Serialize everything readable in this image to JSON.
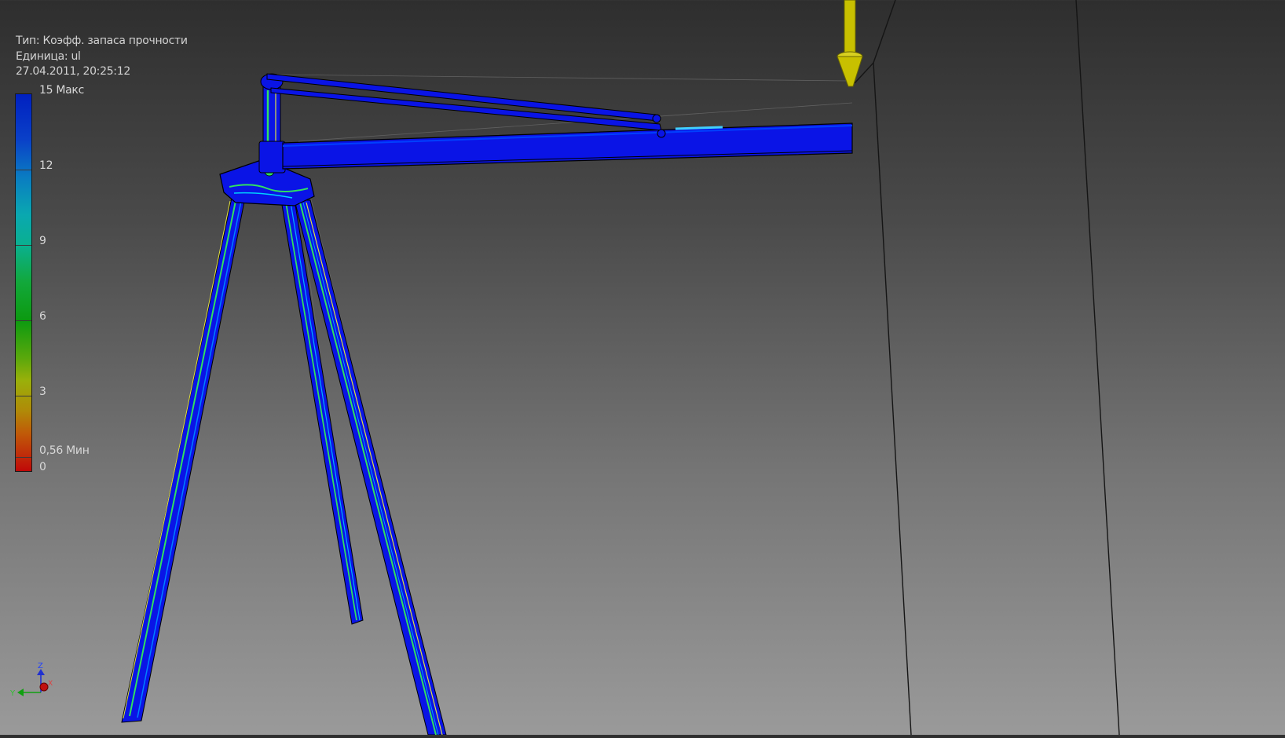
{
  "info": {
    "type_line": "Тип: Коэфф. запаса прочности",
    "unit_line": "Единица: ul",
    "timestamp": "27.04.2011, 20:25:12"
  },
  "legend": {
    "max_label": "15 Макс",
    "label_12": "12",
    "label_9": "9",
    "label_6": "6",
    "label_3": "3",
    "min_label": "0,56 Мин",
    "label_0": "0"
  },
  "axis_triad": {
    "z_label": "Z",
    "y_label": "Y",
    "x_label": "X"
  },
  "colors": {
    "model_blue": "#0a14e6",
    "load_arrow": "#c8c000",
    "hotspot_green": "#30e060",
    "hotspot_yellow": "#e0e040"
  }
}
